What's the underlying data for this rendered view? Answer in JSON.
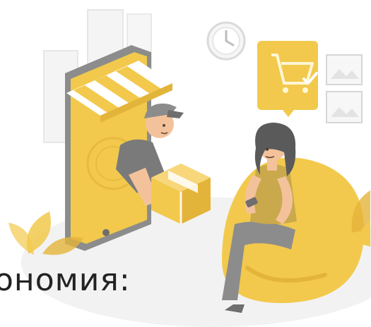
{
  "slide": {
    "caption": "ономия:"
  },
  "illustration": {
    "theme": "online-shopping-delivery",
    "colors": {
      "accent": "#F2C94C",
      "accent_dark": "#E3B43A",
      "grey_light": "#EDEDED",
      "grey_mid": "#C9C9C9",
      "grey_dark": "#8C8C8C",
      "skin": "#F3C29B",
      "hair": "#5A5A5A"
    }
  }
}
